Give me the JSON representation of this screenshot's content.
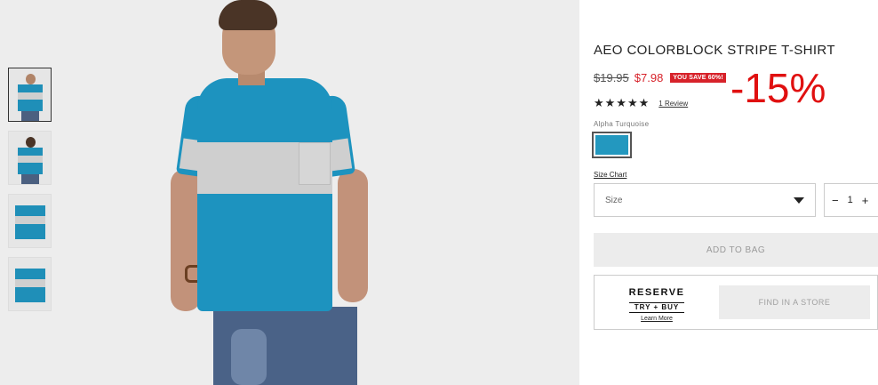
{
  "product": {
    "title": "AEO COLORBLOCK STRIPE T-SHIRT",
    "price_original": "$19.95",
    "price_sale": "$7.98",
    "save_badge": "YOU SAVE 60%!",
    "discount_overlay": "-15%",
    "stars": "★★★★★",
    "review_link": "1 Review",
    "color_name": "Alpha Turquoise",
    "swatch_color": "#2398bf"
  },
  "options": {
    "size_chart_link": "Size Chart",
    "size_select_value": "Size",
    "quantity_value": "1",
    "qty_minus": "−",
    "qty_plus": "+"
  },
  "actions": {
    "add_to_bag": "ADD TO BAG",
    "reserve_title": "RESERVE",
    "reserve_sub": "TRY + BUY",
    "learn_more": "Learn More",
    "find_in_store": "FIND IN A STORE"
  },
  "gallery": {
    "thumbnails": [
      "front-model",
      "back-model",
      "flat-front",
      "flat-back"
    ],
    "active_index": 0
  },
  "colors": {
    "sale_red": "#d7222a",
    "shirt_turquoise": "#1d93bf",
    "stripe_gray": "#cfcfcf"
  }
}
